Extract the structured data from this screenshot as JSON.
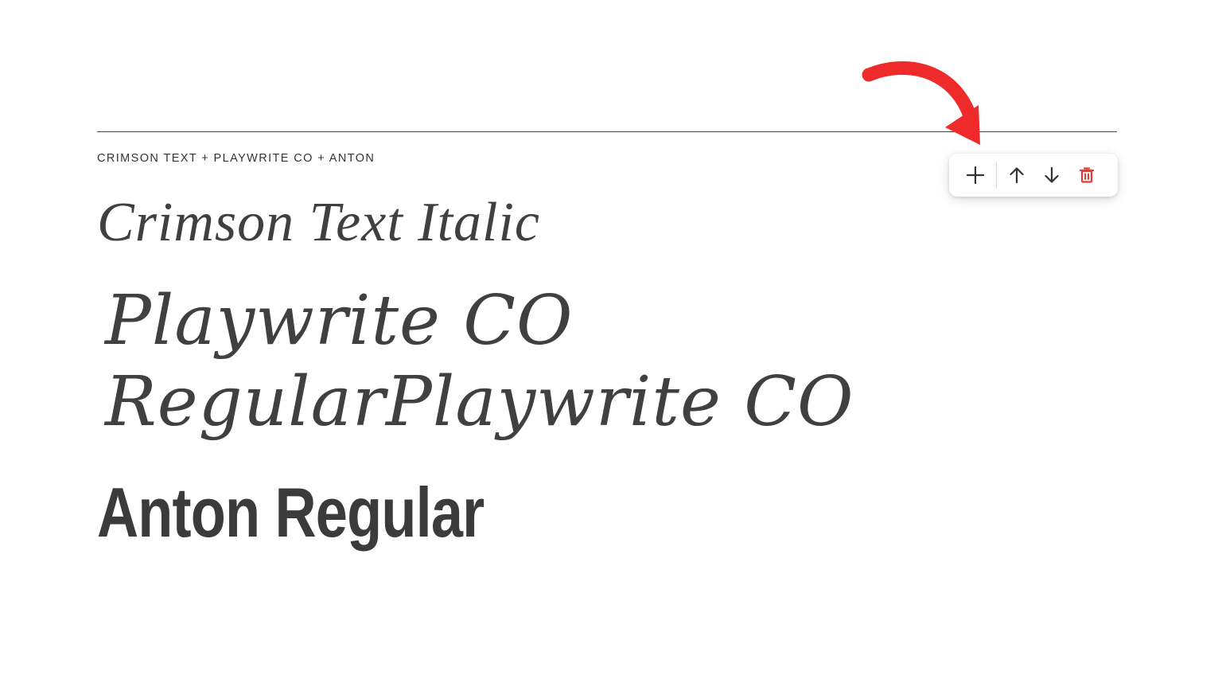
{
  "font_pairing": {
    "label": "CRIMSON TEXT + PLAYWRITE CO + ANTON",
    "specimens": {
      "serif": "Crimson Text Italic",
      "script_line1": "Playwrite CO",
      "script_line2": "RegularPlaywrite CO",
      "display": "Anton Regular"
    }
  },
  "toolbar": {
    "buttons": [
      {
        "name": "add",
        "icon": "plus-icon"
      },
      {
        "name": "move-up",
        "icon": "arrow-up-icon"
      },
      {
        "name": "move-down",
        "icon": "arrow-down-icon"
      },
      {
        "name": "delete",
        "icon": "trash-icon"
      }
    ]
  },
  "colors": {
    "text": "#404040",
    "icon": "#333333",
    "delete": "#e53935",
    "annotation_arrow": "#ee2a2a"
  }
}
